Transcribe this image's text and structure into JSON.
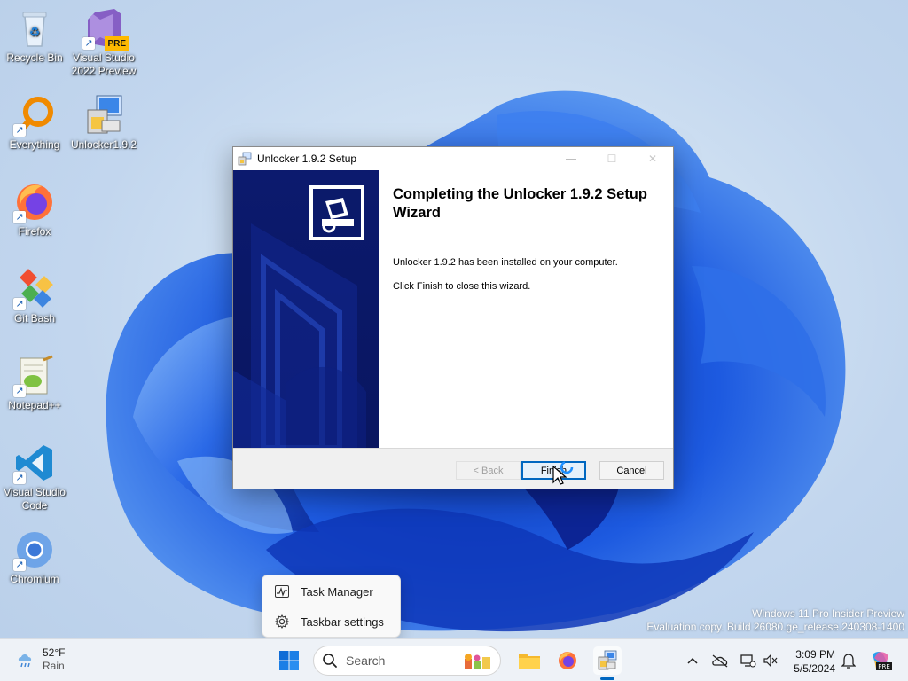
{
  "desktop": {
    "icons": [
      {
        "label": "Recycle Bin",
        "icon": "recycle-bin-icon"
      },
      {
        "label": "Visual Studio\n2022 Preview",
        "icon": "visual-studio-icon",
        "badge": "PRE"
      },
      {
        "label": "Everything",
        "icon": "everything-search-icon"
      },
      {
        "label": "Unlocker1.9.2",
        "icon": "unlocker-installer-icon"
      },
      {
        "label": "Firefox",
        "icon": "firefox-icon"
      },
      {
        "label": "Git Bash",
        "icon": "git-bash-icon"
      },
      {
        "label": "Notepad++",
        "icon": "notepadpp-icon"
      },
      {
        "label": "Visual Studio\nCode",
        "icon": "vscode-icon"
      },
      {
        "label": "Chromium",
        "icon": "chromium-icon"
      }
    ]
  },
  "dialog": {
    "title": "Unlocker 1.9.2 Setup",
    "heading": "Completing the Unlocker 1.9.2 Setup Wizard",
    "message": "Unlocker 1.9.2 has been installed on your computer.",
    "instruction": "Click Finish to close this wizard.",
    "buttons": {
      "back": "< Back",
      "finish": "Finish",
      "cancel": "Cancel"
    },
    "controls": {
      "minimize": "—",
      "maximize": "☐",
      "close": "✕"
    }
  },
  "context_menu": {
    "items": [
      {
        "label": "Task Manager",
        "icon": "task-manager-icon"
      },
      {
        "label": "Taskbar settings",
        "icon": "gear-icon"
      }
    ]
  },
  "watermark": {
    "line1": "Windows 11 Pro Insider Preview",
    "line2": "Evaluation copy. Build 26080.ge_release.240308-1400"
  },
  "taskbar": {
    "weather": {
      "temp": "52°F",
      "condition": "Rain"
    },
    "search_placeholder": "Search",
    "clock": {
      "time": "3:09 PM",
      "date": "5/5/2024"
    }
  },
  "colors": {
    "accent": "#0067c0",
    "wizard_banner": "#0a1868",
    "wallpaper_blue": "#1a56d6"
  }
}
